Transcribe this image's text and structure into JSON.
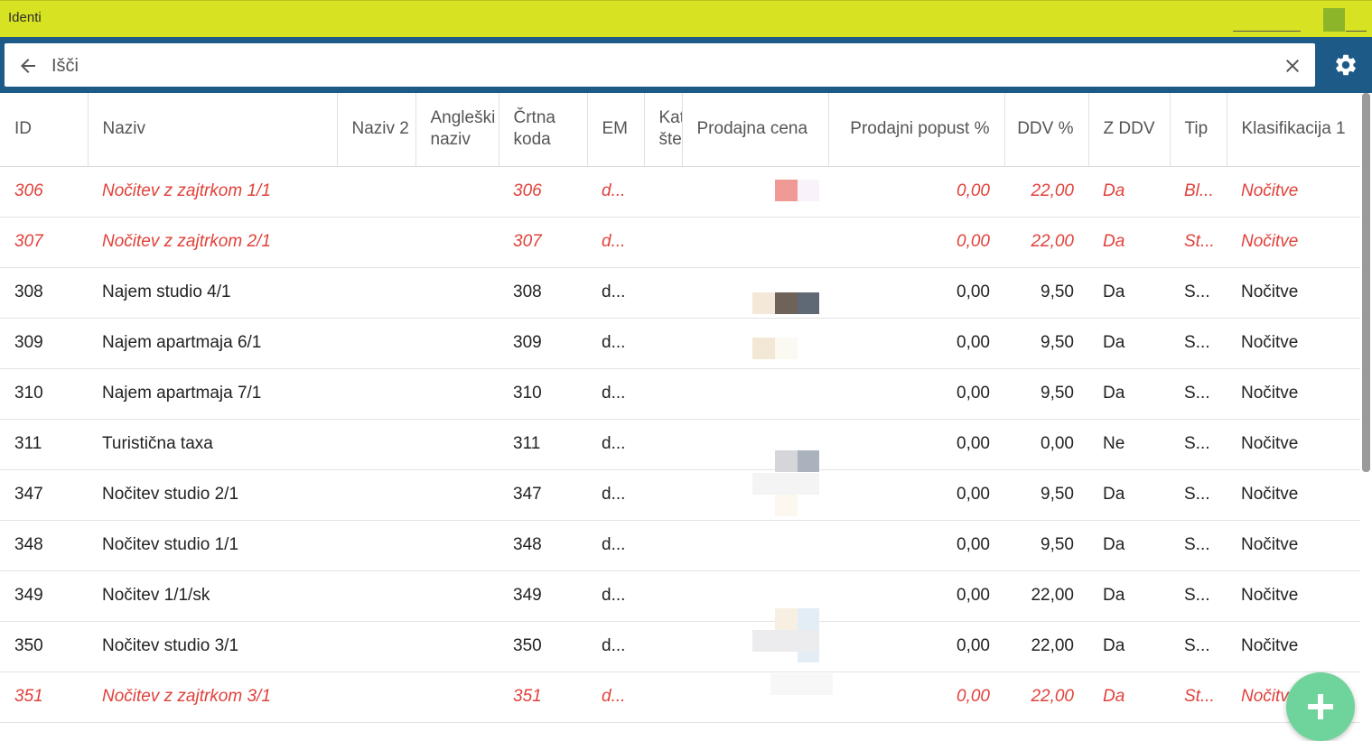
{
  "window": {
    "title": "Identi"
  },
  "search": {
    "placeholder": "Išči",
    "value": ""
  },
  "icons": {
    "back": "arrow-left-icon",
    "clear": "close-icon",
    "settings": "gear-icon",
    "add": "plus-icon"
  },
  "colors": {
    "title_bar": "#d7e222",
    "search_bar": "#1d5a87",
    "highlight_text": "#e0413a",
    "fab": "#6fd49b"
  },
  "table": {
    "columns": [
      {
        "key": "id",
        "label": "ID"
      },
      {
        "key": "naziv",
        "label": "Naziv"
      },
      {
        "key": "naziv2",
        "label": "Naziv 2"
      },
      {
        "key": "angleski",
        "label": "Angleški naziv"
      },
      {
        "key": "crtna",
        "label": "Črtna koda"
      },
      {
        "key": "em",
        "label": "EM"
      },
      {
        "key": "kat",
        "label": "Kat šte"
      },
      {
        "key": "cena",
        "label": "Prodajna cena"
      },
      {
        "key": "popust",
        "label": "Prodajni popust %"
      },
      {
        "key": "ddv",
        "label": "DDV %"
      },
      {
        "key": "zddv",
        "label": "Z DDV"
      },
      {
        "key": "tip",
        "label": "Tip"
      },
      {
        "key": "klas",
        "label": "Klasifikacija 1"
      }
    ],
    "rows": [
      {
        "highlight": true,
        "id": "306",
        "naziv": "Nočitev z zajtrkom 1/1",
        "naziv2": "",
        "angleski": "",
        "crtna": "306",
        "em": "d...",
        "kat": "",
        "cena": "",
        "popust": "0,00",
        "ddv": "22,00",
        "zddv": "Da",
        "tip": "Bl...",
        "klas": "Nočitve"
      },
      {
        "highlight": true,
        "id": "307",
        "naziv": "Nočitev z zajtrkom 2/1",
        "naziv2": "",
        "angleski": "",
        "crtna": "307",
        "em": "d...",
        "kat": "",
        "cena": "",
        "popust": "0,00",
        "ddv": "22,00",
        "zddv": "Da",
        "tip": "St...",
        "klas": "Nočitve"
      },
      {
        "highlight": false,
        "id": "308",
        "naziv": "Najem studio 4/1",
        "naziv2": "",
        "angleski": "",
        "crtna": "308",
        "em": "d...",
        "kat": "",
        "cena": "",
        "popust": "0,00",
        "ddv": "9,50",
        "zddv": "Da",
        "tip": "S...",
        "klas": "Nočitve"
      },
      {
        "highlight": false,
        "id": "309",
        "naziv": "Najem apartmaja 6/1",
        "naziv2": "",
        "angleski": "",
        "crtna": "309",
        "em": "d...",
        "kat": "",
        "cena": "",
        "popust": "0,00",
        "ddv": "9,50",
        "zddv": "Da",
        "tip": "S...",
        "klas": "Nočitve"
      },
      {
        "highlight": false,
        "id": "310",
        "naziv": "Najem apartmaja 7/1",
        "naziv2": "",
        "angleski": "",
        "crtna": "310",
        "em": "d...",
        "kat": "",
        "cena": "",
        "popust": "0,00",
        "ddv": "9,50",
        "zddv": "Da",
        "tip": "S...",
        "klas": "Nočitve"
      },
      {
        "highlight": false,
        "id": "311",
        "naziv": "Turistična taxa",
        "naziv2": "",
        "angleski": "",
        "crtna": "311",
        "em": "d...",
        "kat": "",
        "cena": "",
        "popust": "0,00",
        "ddv": "0,00",
        "zddv": "Ne",
        "tip": "S...",
        "klas": "Nočitve"
      },
      {
        "highlight": false,
        "id": "347",
        "naziv": "Nočitev studio 2/1",
        "naziv2": "",
        "angleski": "",
        "crtna": "347",
        "em": "d...",
        "kat": "",
        "cena": "",
        "popust": "0,00",
        "ddv": "9,50",
        "zddv": "Da",
        "tip": "S...",
        "klas": "Nočitve"
      },
      {
        "highlight": false,
        "id": "348",
        "naziv": "Nočitev studio 1/1",
        "naziv2": "",
        "angleski": "",
        "crtna": "348",
        "em": "d...",
        "kat": "",
        "cena": "",
        "popust": "0,00",
        "ddv": "9,50",
        "zddv": "Da",
        "tip": "S...",
        "klas": "Nočitve"
      },
      {
        "highlight": false,
        "id": "349",
        "naziv": "Nočitev 1/1/sk",
        "naziv2": "",
        "angleski": "",
        "crtna": "349",
        "em": "d...",
        "kat": "",
        "cena": "",
        "popust": "0,00",
        "ddv": "22,00",
        "zddv": "Da",
        "tip": "S...",
        "klas": "Nočitve"
      },
      {
        "highlight": false,
        "id": "350",
        "naziv": "Nočitev studio 3/1",
        "naziv2": "",
        "angleski": "",
        "crtna": "350",
        "em": "d...",
        "kat": "",
        "cena": "",
        "popust": "0,00",
        "ddv": "22,00",
        "zddv": "Da",
        "tip": "S...",
        "klas": "Nočitve"
      },
      {
        "highlight": true,
        "id": "351",
        "naziv": "Nočitev z zajtrkom 3/1",
        "naziv2": "",
        "angleski": "",
        "crtna": "351",
        "em": "d...",
        "kat": "",
        "cena": "",
        "popust": "0,00",
        "ddv": "22,00",
        "zddv": "Da",
        "tip": "St...",
        "klas": "Nočitve"
      }
    ]
  }
}
